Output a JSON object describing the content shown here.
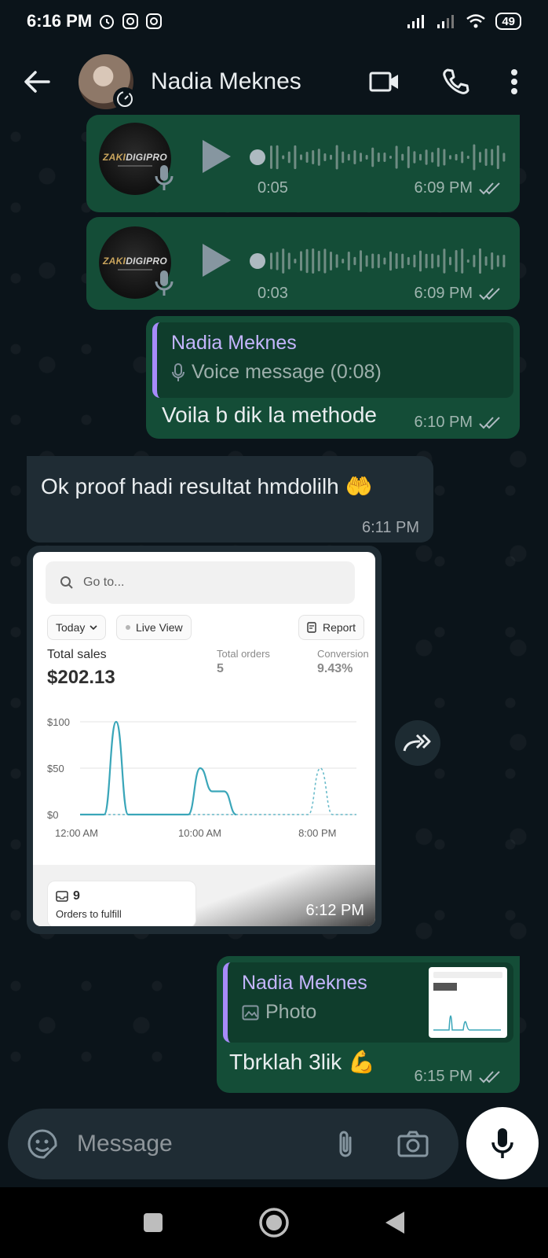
{
  "status_bar": {
    "time": "6:16 PM",
    "battery": "49"
  },
  "header": {
    "contact_name": "Nadia Meknes"
  },
  "messages": {
    "voice1": {
      "duration": "0:05",
      "time": "6:09 PM",
      "thumb_brand_left": "ZAKI",
      "thumb_brand_right": "DIGIPRO"
    },
    "voice2": {
      "duration": "0:03",
      "time": "6:09 PM",
      "thumb_brand_left": "ZAKI",
      "thumb_brand_right": "DIGIPRO"
    },
    "reply1": {
      "quote_name": "Nadia Meknes",
      "quote_text": "Voice message (0:08)",
      "text": "Voila b dik la methode",
      "time": "6:10 PM"
    },
    "incoming1": {
      "text": "Ok proof hadi resultat hmdolilh 🤲",
      "time": "6:11 PM"
    },
    "image": {
      "time": "6:12 PM",
      "search_placeholder": "Go to...",
      "pill_today": "Today",
      "pill_live": "Live View",
      "pill_report": "Report",
      "total_sales_label": "Total sales",
      "total_sales_value": "$202.13",
      "total_orders_label": "Total orders",
      "total_orders_value": "5",
      "conversion_label": "Conversion",
      "conversion_value": "9.43%",
      "orders_count": "9",
      "orders_label": "Orders to fulfill"
    },
    "reply2": {
      "quote_name": "Nadia Meknes",
      "quote_text": "Photo",
      "text": "Tbrklah 3lik 💪",
      "time": "6:15 PM"
    }
  },
  "chart_data": {
    "type": "line",
    "title": "",
    "xlabel": "",
    "ylabel": "",
    "x_ticks": [
      "12:00 AM",
      "10:00 AM",
      "8:00 PM"
    ],
    "y_ticks": [
      "$100",
      "$50",
      "$0"
    ],
    "ylim": [
      0,
      100
    ],
    "series": [
      {
        "name": "",
        "style": "solid",
        "x_hours": [
          0,
          1,
          2,
          3,
          4,
          5,
          6,
          7,
          8,
          9,
          10,
          11,
          12,
          13,
          14,
          15,
          16,
          17,
          18,
          19,
          20,
          21,
          22,
          23
        ],
        "values": [
          0,
          0,
          0,
          100,
          0,
          0,
          0,
          0,
          0,
          0,
          50,
          25,
          25,
          0,
          null,
          null,
          null,
          null,
          null,
          null,
          null,
          null,
          null,
          null
        ]
      },
      {
        "name": "",
        "style": "dashed",
        "x_hours": [
          0,
          1,
          2,
          3,
          4,
          5,
          6,
          7,
          8,
          9,
          10,
          11,
          12,
          13,
          14,
          15,
          16,
          17,
          18,
          19,
          20,
          21,
          22,
          23
        ],
        "values": [
          0,
          0,
          0,
          0,
          0,
          0,
          0,
          0,
          0,
          0,
          0,
          0,
          0,
          0,
          0,
          0,
          0,
          0,
          0,
          0,
          50,
          0,
          0,
          0
        ]
      }
    ]
  },
  "composer": {
    "placeholder": "Message"
  },
  "colors": {
    "outgoing_bubble": "#144d37",
    "incoming_bubble": "#1f2c34",
    "quote_accent": "#a78bfa",
    "chart_line": "#3aa6b9"
  }
}
